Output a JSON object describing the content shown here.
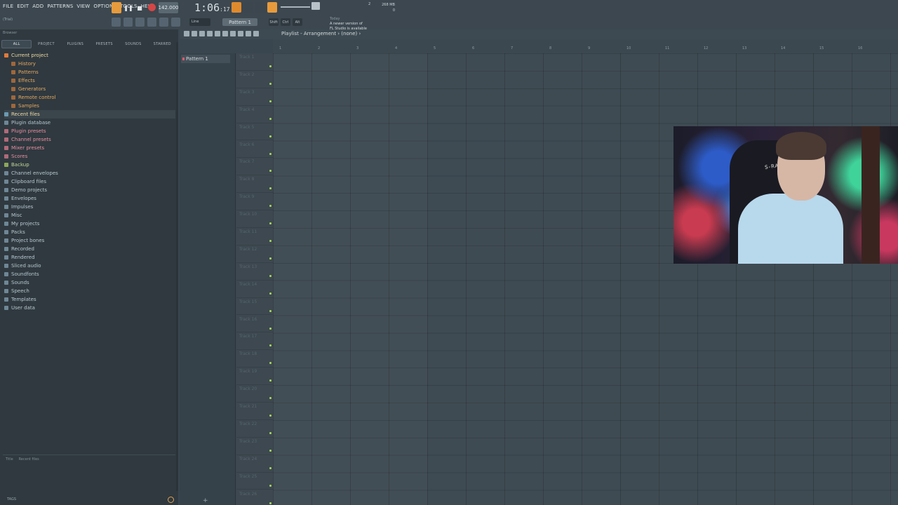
{
  "menu": [
    "FILE",
    "EDIT",
    "ADD",
    "PATTERNS",
    "VIEW",
    "OPTIONS",
    "TOOLS",
    "HELP"
  ],
  "transport": {
    "tempo": "142.000",
    "time_main": "1:06",
    "time_sub": "17"
  },
  "hint": "(Trial)",
  "cpu": {
    "left": "1",
    "mid": "2",
    "mem": "268 MB",
    "poly": "0"
  },
  "news": {
    "day": "Today",
    "line1": "A newer version of",
    "line2": "FL Studio is available"
  },
  "toolbar2": {
    "snap": "Line",
    "pattern": "Pattern 1",
    "keys": [
      "Shift",
      "Ctrl",
      "Alt"
    ]
  },
  "browser": {
    "header": "Browser",
    "tabs": [
      "ALL",
      "PROJECT",
      "PLUGINS",
      "PRESETS",
      "SOUNDS",
      "STARRED"
    ],
    "current_project": "Current project",
    "project_items": [
      "History",
      "Patterns",
      "Effects",
      "Generators",
      "Remote control",
      "Samples"
    ],
    "recent_files": "Recent files",
    "items": [
      {
        "label": "Plugin database",
        "style": "normal"
      },
      {
        "label": "Plugin presets",
        "style": "pinkish"
      },
      {
        "label": "Channel presets",
        "style": "pinkish"
      },
      {
        "label": "Mixer presets",
        "style": "pinkish"
      },
      {
        "label": "Scores",
        "style": "pinkish"
      },
      {
        "label": "Backup",
        "style": "green"
      },
      {
        "label": "Channel envelopes",
        "style": "normal"
      },
      {
        "label": "Clipboard files",
        "style": "normal"
      },
      {
        "label": "Demo projects",
        "style": "normal"
      },
      {
        "label": "Envelopes",
        "style": "normal"
      },
      {
        "label": "Impulses",
        "style": "normal"
      },
      {
        "label": "Misc",
        "style": "normal"
      },
      {
        "label": "My projects",
        "style": "normal"
      },
      {
        "label": "Packs",
        "style": "normal"
      },
      {
        "label": "Project bones",
        "style": "normal"
      },
      {
        "label": "Recorded",
        "style": "normal"
      },
      {
        "label": "Rendered",
        "style": "normal"
      },
      {
        "label": "Sliced audio",
        "style": "normal"
      },
      {
        "label": "Soundfonts",
        "style": "normal"
      },
      {
        "label": "Sounds",
        "style": "normal"
      },
      {
        "label": "Speech",
        "style": "normal"
      },
      {
        "label": "Templates",
        "style": "normal"
      },
      {
        "label": "User data",
        "style": "normal"
      }
    ],
    "footer_title": "Title",
    "footer_recent": "Recent files",
    "tags": "TAGS"
  },
  "playlist": {
    "title": "Playlist - Arrangement › (none) ›",
    "pattern_item": "Pattern 1",
    "bars": [
      "1",
      "2",
      "3",
      "4",
      "5",
      "6",
      "7",
      "8",
      "9",
      "10",
      "11",
      "12",
      "13",
      "14",
      "15",
      "16"
    ],
    "tracks": [
      "Track 1",
      "Track 2",
      "Track 3",
      "Track 4",
      "Track 5",
      "Track 6",
      "Track 7",
      "Track 8",
      "Track 9",
      "Track 10",
      "Track 11",
      "Track 12",
      "Track 13",
      "Track 14",
      "Track 15",
      "Track 16",
      "Track 17",
      "Track 18",
      "Track 19",
      "Track 20",
      "Track 21",
      "Track 22",
      "Track 23",
      "Track 24",
      "Track 25",
      "Track 26"
    ]
  },
  "webcam": {
    "chair_text": "S-RACING"
  },
  "colors": {
    "accent_orange": "#e79b3c",
    "record_red": "#d64646",
    "track_led": "#a9d95e"
  }
}
